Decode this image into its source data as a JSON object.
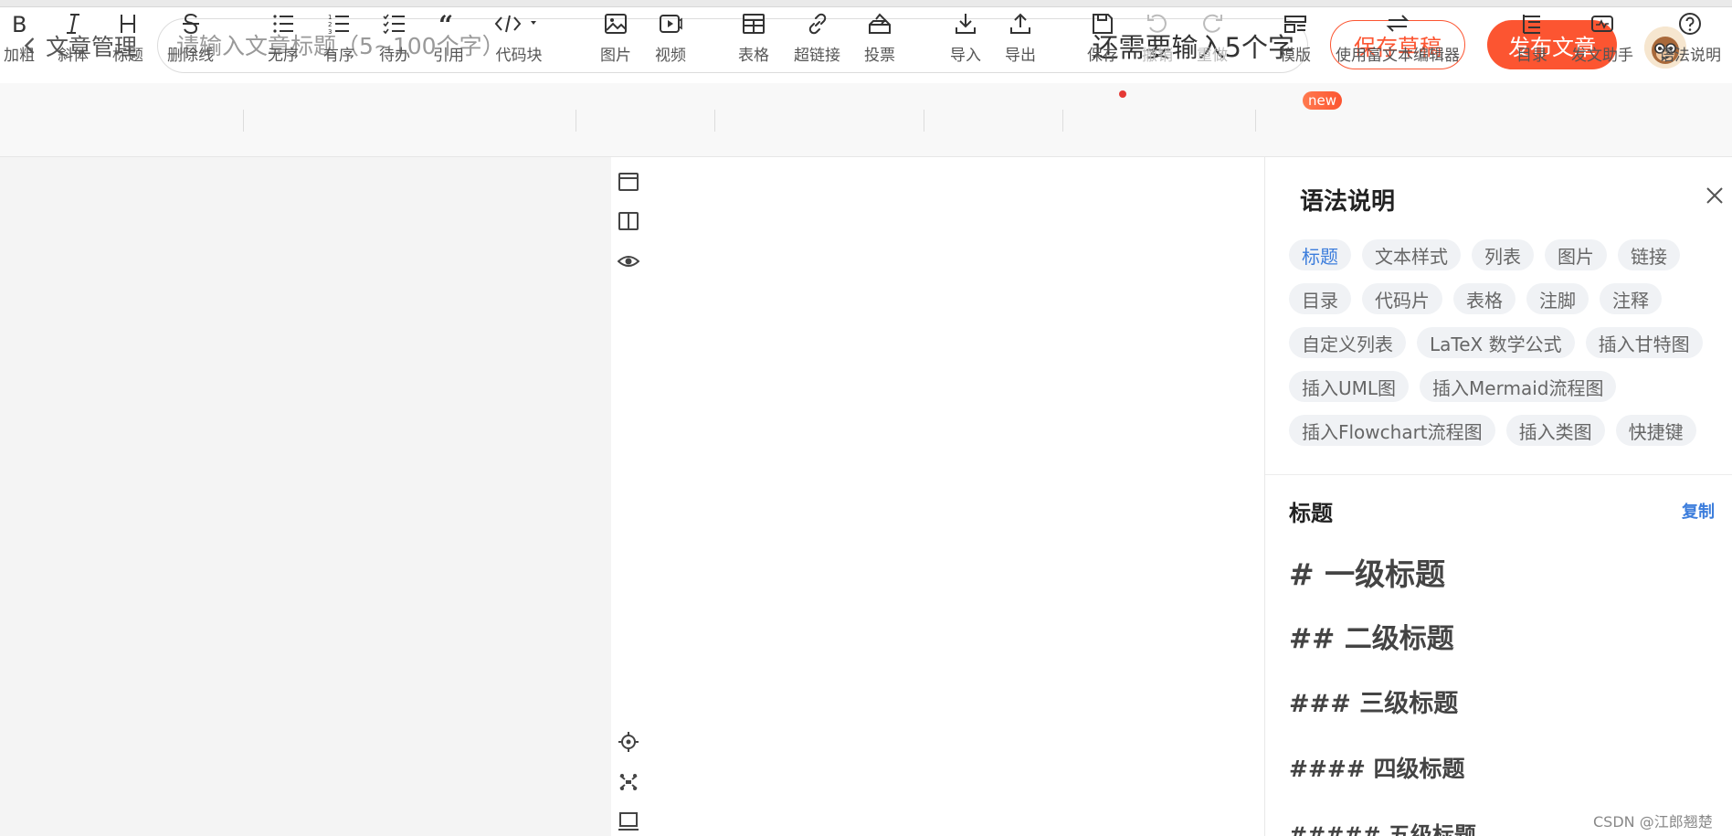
{
  "header": {
    "back_label": "文章管理",
    "title_placeholder": "请输入文章标题（5~100个字）",
    "title_value": "",
    "title_counter": "还需要输入5个字",
    "save_draft_label": "保存草稿",
    "publish_label": "发布文章"
  },
  "toolbar": {
    "bold": "加粗",
    "italic": "斜体",
    "heading": "标题",
    "strike": "删除线",
    "unordered": "无序",
    "ordered": "有序",
    "todo": "待办",
    "quote": "引用",
    "codeblock": "代码块",
    "image": "图片",
    "video": "视频",
    "table": "表格",
    "hyperlink": "超链接",
    "vote": "投票",
    "import": "导入",
    "export": "导出",
    "save": "保存",
    "undo": "撤销",
    "redo": "重做",
    "template": "模版",
    "template_badge": "new",
    "richtext": "使用富文本编辑器",
    "toc": "目录",
    "assistant": "发文助手",
    "syntax": "语法说明"
  },
  "syntax_panel": {
    "title": "语法说明",
    "chips": [
      "标题",
      "文本样式",
      "列表",
      "图片",
      "链接",
      "目录",
      "代码片",
      "表格",
      "注脚",
      "注释",
      "自定义列表",
      "LaTeX 数学公式",
      "插入甘特图",
      "插入UML图",
      "插入Mermaid流程图",
      "插入Flowchart流程图",
      "插入类图",
      "快捷键"
    ],
    "active_chip": "标题",
    "section_title": "标题",
    "copy_label": "复制",
    "examples": [
      "# 一级标题",
      "## 二级标题",
      "### 三级标题",
      "#### 四级标题",
      "##### 五级标题"
    ]
  },
  "watermark": "CSDN @江郎翘楚",
  "colors": {
    "accent": "#fc5531",
    "link": "#3c7ddc"
  }
}
